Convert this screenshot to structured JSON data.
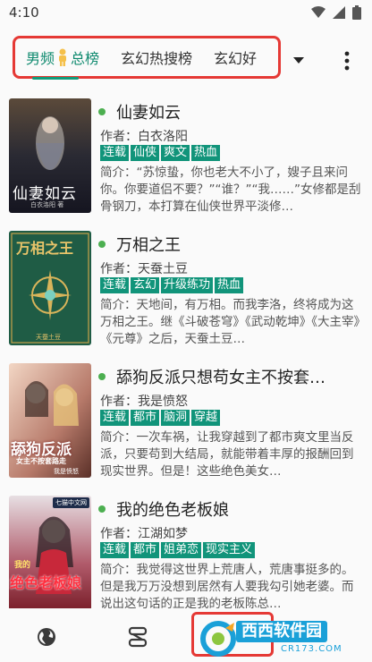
{
  "status": {
    "time": "4:10"
  },
  "tabs": {
    "items": [
      {
        "label": "男频",
        "icon": "person-icon",
        "label2": "总榜"
      },
      {
        "label": "玄幻热搜榜"
      },
      {
        "label": "玄幻好"
      }
    ],
    "active_color": "#0f8a6f"
  },
  "books": [
    {
      "title": "仙妻如云",
      "author": "作者：白衣洛阳",
      "tags": [
        "连载",
        "仙侠",
        "爽文",
        "热血"
      ],
      "intro": "简介：“苏惊蛰，你也老大不小了，嫂子且来问你。你要道侣不要？”“谁？”“我……”女修都是刮骨钢刀，本打算在仙侠世界平淡修…",
      "cover": {
        "text": "仙妻如云",
        "sub": "白衣洛阳 著"
      }
    },
    {
      "title": "万相之王",
      "author": "作者：天蚕土豆",
      "tags": [
        "连载",
        "玄幻",
        "升级练功",
        "热血"
      ],
      "intro": "简介：天地间，有万相。而我李洛，终将成为这万相之王。继《斗破苍穹》《武动乾坤》《大主宰》《元尊》之后，天蚕土豆…",
      "cover": {
        "text": "万相之王",
        "sub": "天蚕土豆"
      }
    },
    {
      "title": "舔狗反派只想苟女主不按套…",
      "author": "作者：我是愤怒",
      "tags": [
        "连载",
        "都市",
        "脑洞",
        "穿越"
      ],
      "intro": "简介：一次车祸，让我穿越到了都市爽文里当反派，只要苟到大结局，就能带着丰厚的报酬回到现实世界。但是！这些绝色美女…",
      "cover": {
        "text": "舔狗反派",
        "sub": "女主不按套路走",
        "author": "我是愤怒"
      }
    },
    {
      "title": "我的绝色老板娘",
      "author": "作者：江湖如梦",
      "tags": [
        "连载",
        "都市",
        "姐弟恋",
        "现实主义"
      ],
      "intro": "简介：我觉得这世界上荒唐人，荒唐事挺多的。但是我万万没想到居然有人要我勾引她老婆。而说出这句话的正是我的老板陈总…",
      "cover": {
        "text": "绝色老板娘",
        "sub": "我的",
        "badge": "七猫中文网"
      }
    }
  ],
  "watermark": {
    "text": "西西软件园",
    "sub": "CR173.COM"
  },
  "nav": [
    "globe-icon",
    "bookshelf-icon",
    "app-logo-icon"
  ]
}
